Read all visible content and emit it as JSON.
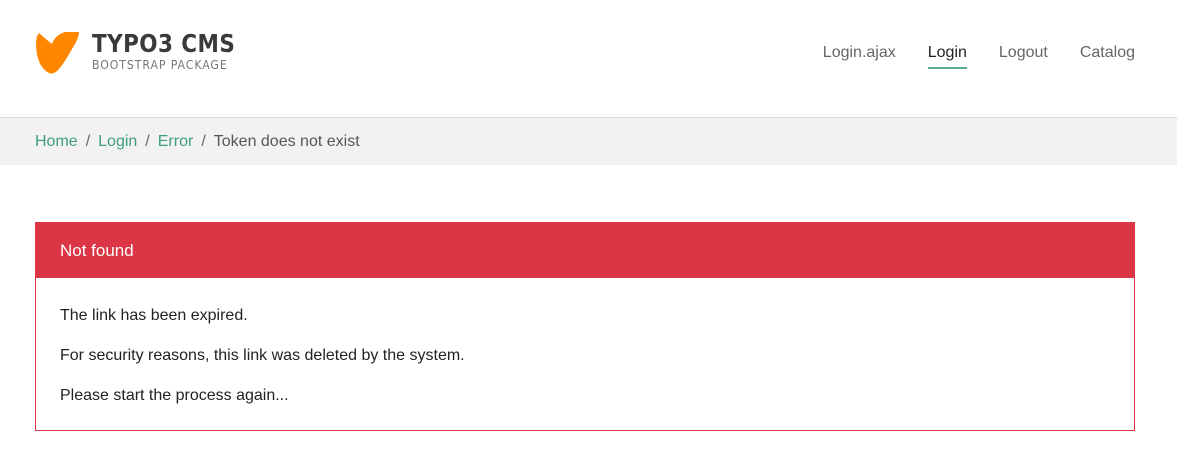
{
  "header": {
    "brand": {
      "title": "TYPO3 CMS",
      "subtitle": "BOOTSTRAP PACKAGE",
      "logo_icon": "typo3-logo-icon",
      "logo_color": "#ff8700"
    },
    "nav": [
      {
        "label": "Login.ajax",
        "active": false
      },
      {
        "label": "Login",
        "active": true
      },
      {
        "label": "Logout",
        "active": false
      },
      {
        "label": "Catalog",
        "active": false
      }
    ],
    "active_underline_color": "#5cab8f"
  },
  "breadcrumb": {
    "items": [
      {
        "label": "Home",
        "link": true
      },
      {
        "label": "Login",
        "link": true
      },
      {
        "label": "Error",
        "link": true
      },
      {
        "label": "Token does not exist",
        "link": false
      }
    ],
    "separator": "/",
    "link_color": "#3f9c80"
  },
  "alert": {
    "title": "Not found",
    "color": "#dc3545",
    "messages": [
      "The link has been expired.",
      "For security reasons, this link was deleted by the system.",
      "Please start the process again..."
    ]
  }
}
